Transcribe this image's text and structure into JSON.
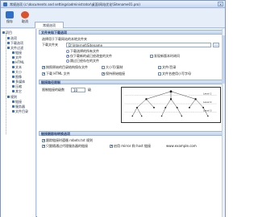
{
  "window": {
    "title": "常规选项 (c:\\documents and settings\\administrator\\桌面\\网站优化\\Sitename01.pro)"
  },
  "toolbar": {
    "buttons": [
      {
        "label": "保存",
        "color": "#2f6fc9"
      },
      {
        "label": "取消",
        "color": "#d9532c"
      }
    ],
    "tab_label": "常规选项"
  },
  "sidebar": {
    "items": [
      {
        "label": "项目",
        "color": "#3b6fc4"
      },
      {
        "label": "选项",
        "color": "#3b6fc4"
      },
      {
        "label": "下载选项",
        "color": "#3b6fc4"
      },
      {
        "label": "文件过滤",
        "color": "#3b6fc4"
      },
      {
        "label": "链接",
        "color": "#3b6fc4"
      },
      {
        "label": "文件",
        "color": "#3b6fc4"
      },
      {
        "label": "HTML",
        "color": "#3b6fc4"
      },
      {
        "label": "文本",
        "color": "#3b6fc4"
      },
      {
        "label": "大小",
        "color": "#3b6fc4"
      },
      {
        "label": "图像",
        "color": "#3b6fc4"
      },
      {
        "label": "多媒体",
        "color": "#3b6fc4"
      },
      {
        "label": "压缩",
        "color": "#3b6fc4"
      },
      {
        "label": "其它",
        "color": "#3b6fc4"
      },
      {
        "label": "规则",
        "color": "#3b6fc4"
      },
      {
        "label": "链接",
        "color": "#3b6fc4"
      },
      {
        "label": "服务器",
        "color": "#3b6fc4"
      },
      {
        "label": "文件目录",
        "color": "#3b6fc4"
      }
    ]
  },
  "sections": {
    "download_folder": {
      "header": "文件夹和下载选项",
      "desc": "选择用于下载网站的本地文件夹",
      "folder_label": "下载文件夹",
      "folder_value": "D:\\Internet\\Sitename",
      "browse_label": "...",
      "radio_download_all": "下载选择的所有文件",
      "radio_overwrite": "仅下载新的或已经改变的文件",
      "radio_skip": "跳过已经存在的文件",
      "check_ask": "发现新版本时询问",
      "check_create_dirs": "按照原始的目录结构保存文件",
      "check_download_html": "下载 HTML 文件",
      "check_follow_links": "保持原始链接",
      "check_lowercase": "文件名使用小写字母",
      "check_case": "大小写/复制",
      "check_file": "文件/目录"
    },
    "level": {
      "header": "链接路径限制",
      "depth_label": "限制链接的级数",
      "depth_value": "10",
      "depth_unit": "级",
      "level_labels": [
        "Level 1",
        "Level 2",
        "Level 3"
      ]
    },
    "links": {
      "header": "链接跟踪和转换选项",
      "check_convert": "跟踪链接时遵循 robots.txt 规则",
      "check_url": "只跟随通过代理服务器的链接",
      "check_extra": "启用 mirror 和 host 链接",
      "other_domain": "www.example.com"
    }
  }
}
